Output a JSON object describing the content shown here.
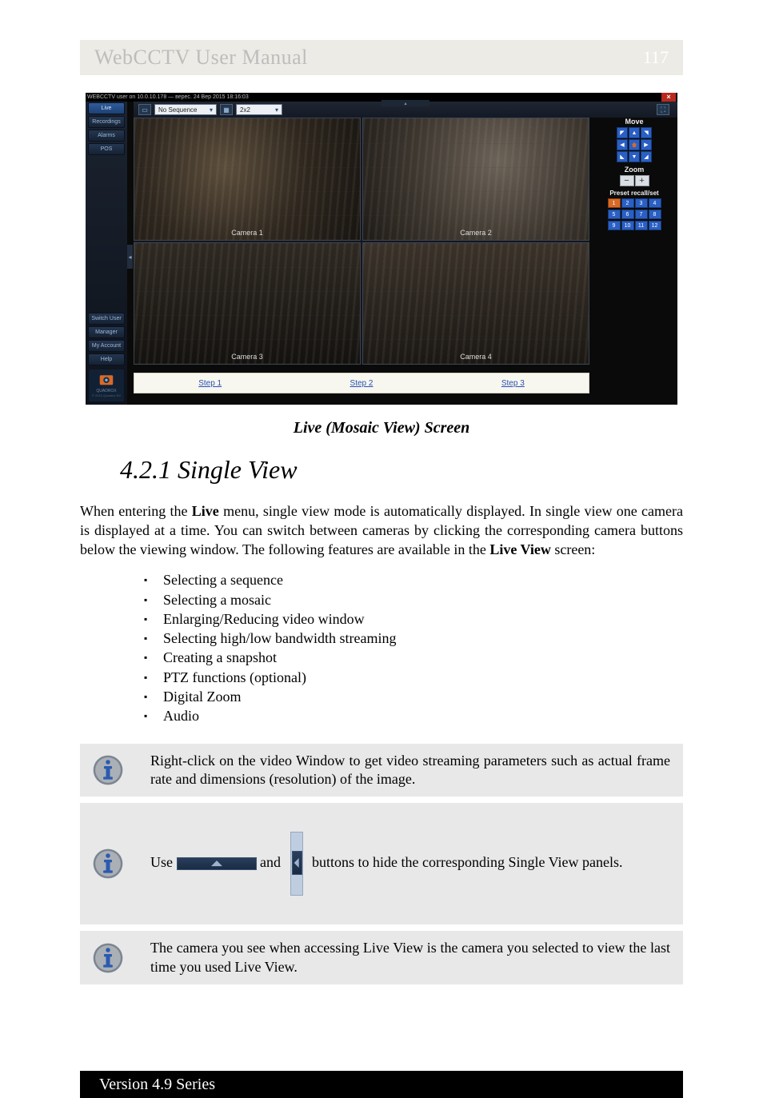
{
  "header": {
    "title_left": "WebCCTV User Manual",
    "title_right": "117"
  },
  "screenshot": {
    "titlebar_text": "WEBCCTV user on 10.0.10.178 — верес. 24 Вер 2015 18:16:03",
    "close": "×",
    "sidebar_top": [
      "Live",
      "Recordings",
      "Alarms",
      "POS"
    ],
    "sidebar_bottom": [
      "Switch User",
      "Manager",
      "My Account",
      "Help"
    ],
    "logo_text": "QUADROX",
    "logo_sub": "© 2015 Quadrox NV",
    "toolbar": {
      "seq_label": "No Sequence",
      "mosaic_label": "2x2"
    },
    "cameras": [
      "Camera 1",
      "Camera 2",
      "Camera 3",
      "Camera 4"
    ],
    "steps": [
      "Step 1",
      "Step 2",
      "Step 3"
    ],
    "ptz": {
      "move": "Move",
      "zoom": "Zoom",
      "preset": "Preset recall/set",
      "presets": [
        "1",
        "2",
        "3",
        "4",
        "5",
        "6",
        "7",
        "8",
        "9",
        "10",
        "11",
        "12"
      ]
    }
  },
  "caption": "Live (Mosaic View) Screen",
  "section_heading": "4.2.1 Single View",
  "para_intro_pre": "When entering the ",
  "para_intro_bold1": "Live",
  "para_intro_mid": " menu, single view mode is automatically displayed. In single view one camera is displayed at a time. You can switch between cameras by clicking the corresponding camera buttons below the viewing window. The following features are available in the ",
  "para_intro_bold2": "Live View",
  "para_intro_post": " screen:",
  "features": [
    "Selecting a sequence",
    "Selecting a mosaic",
    "Enlarging/Reducing video window",
    "Selecting high/low bandwidth streaming",
    "Creating a snapshot",
    "PTZ functions (optional)",
    "Digital Zoom",
    "Audio"
  ],
  "note1": "Right-click on the video Window to get video streaming parameters such as actual frame rate and dimensions (resolution) of the image.",
  "note2_pre": "Use ",
  "note2_mid": " and ",
  "note2_post": " buttons to hide the corresponding Single View panels.",
  "note3": "The camera you see when accessing Live View is the camera you selected to view the last time you used Live View.",
  "footer": "Version 4.9 Series"
}
